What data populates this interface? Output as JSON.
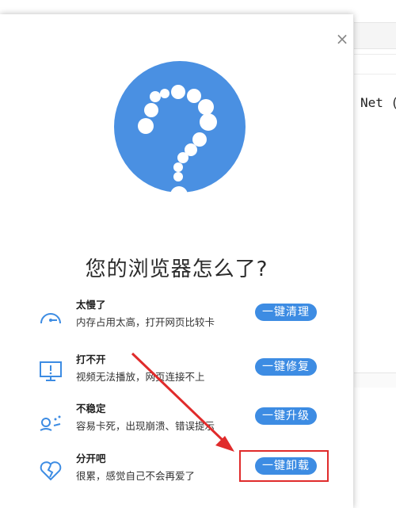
{
  "background": {
    "partial_text": "Net ("
  },
  "dialog": {
    "close_symbol": "×",
    "headline": "您的浏览器怎么了?",
    "items": [
      {
        "title": "太慢了",
        "desc": "内存占用太高，打开网页比较卡",
        "button": "一键清理",
        "icon": "speedometer-icon"
      },
      {
        "title": "打不开",
        "desc": "视频无法播放，网页连接不上",
        "button": "一键修复",
        "icon": "monitor-alert-icon"
      },
      {
        "title": "不稳定",
        "desc": "容易卡死，出现崩溃、错误提示",
        "button": "一键升级",
        "icon": "unstable-icon"
      },
      {
        "title": "分开吧",
        "desc": "很累，感觉自己不会再爱了",
        "button": "一键卸载",
        "icon": "broken-heart-icon"
      }
    ]
  },
  "colors": {
    "accent": "#3d8ce3",
    "circle": "#4a90e2",
    "annotation": "#e02b2b"
  }
}
